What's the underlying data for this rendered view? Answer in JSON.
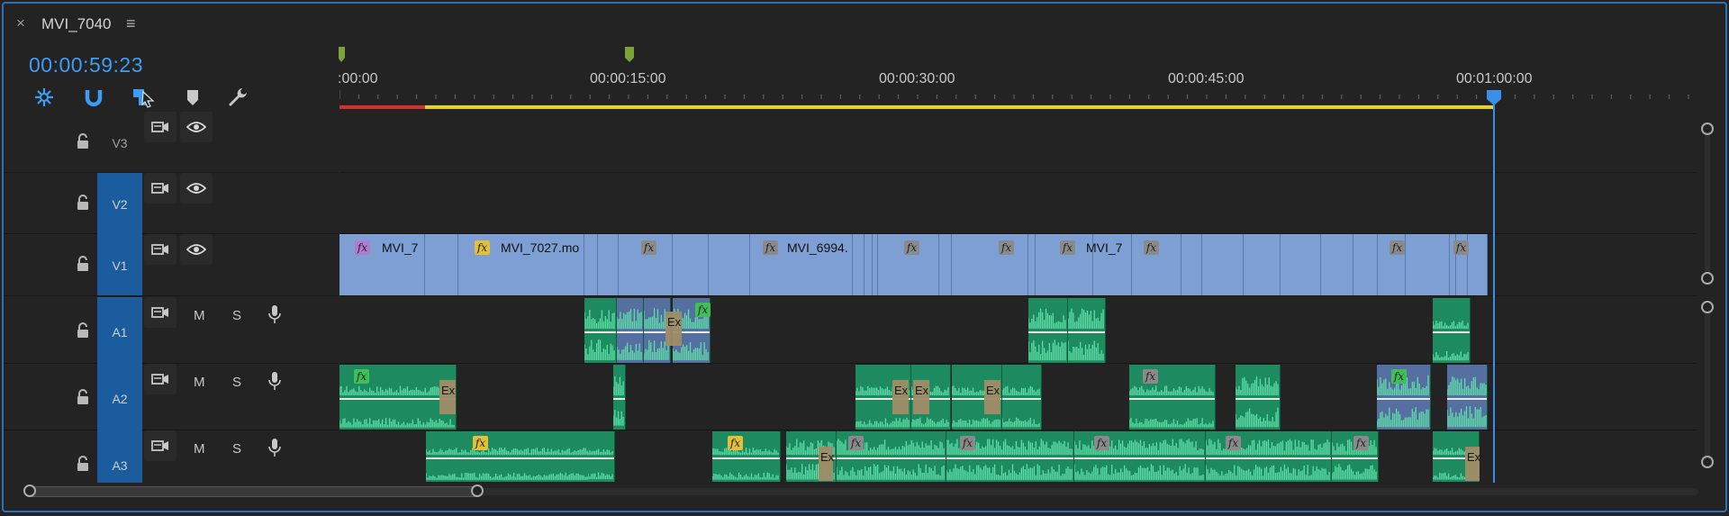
{
  "panel": {
    "close_glyph": "×",
    "title": "MVI_7040",
    "menu_glyph": "≡"
  },
  "timecode": "00:00:59:23",
  "tools": [
    {
      "name": "insert-overwrite-sequences-icon"
    },
    {
      "name": "snap-magnet-icon"
    },
    {
      "name": "linked-selection-icon"
    },
    {
      "name": "add-marker-icon"
    },
    {
      "name": "timeline-settings-wrench-icon"
    }
  ],
  "ruler": {
    "labels": [
      ":00:00",
      "00:00:15:00",
      "00:00:30:00",
      "00:00:45:00",
      "00:01:00:00"
    ]
  },
  "tracks": {
    "video": [
      {
        "id": "V3",
        "targeted": false
      },
      {
        "id": "V2",
        "targeted": true
      },
      {
        "id": "V1",
        "targeted": true
      }
    ],
    "audio": [
      {
        "id": "A1",
        "targeted": true,
        "mute": "M",
        "solo": "S"
      },
      {
        "id": "A2",
        "targeted": true,
        "mute": "M",
        "solo": "S"
      },
      {
        "id": "A3",
        "targeted": true,
        "mute": "M",
        "solo": "S"
      }
    ]
  },
  "clips": {
    "v1_labels": [
      "MVI_7",
      "MVI_7027.mo",
      "MVI_6994.",
      "MVI_7"
    ],
    "fx": "fx",
    "transition": "Ex"
  },
  "colors": {
    "accent": "#3d9df5",
    "video_clip": "#7d9fd3",
    "audio_clip": "#1d8a60",
    "target": "#1a5c9e",
    "workbar_red": "#d62f2f",
    "workbar_yellow": "#e8d21a"
  }
}
